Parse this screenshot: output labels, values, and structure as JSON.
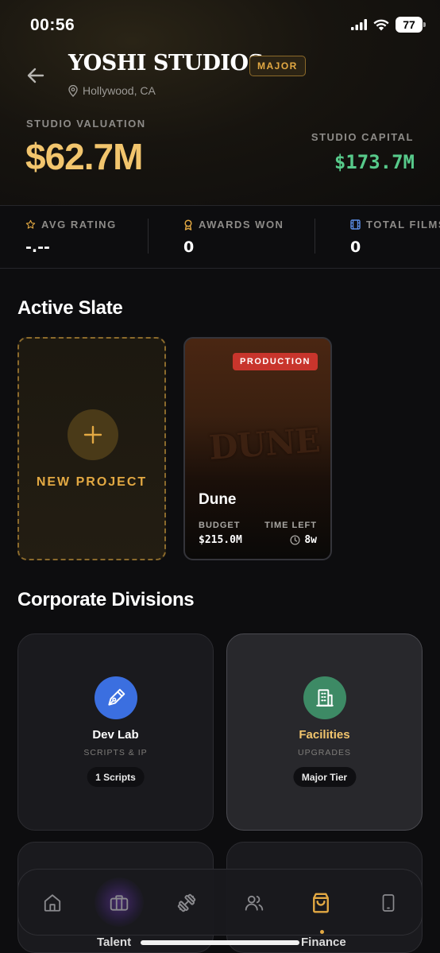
{
  "status_bar": {
    "time": "00:56",
    "battery": "77"
  },
  "header": {
    "studio_name": "YOSHI STUDIOS",
    "tier": "MAJOR",
    "location": "Hollywood, CA",
    "valuation_label": "STUDIO VALUATION",
    "valuation_value": "$62.7M",
    "capital_label": "STUDIO CAPITAL",
    "capital_value": "$173.7M"
  },
  "stats": [
    {
      "label": "AVG RATING",
      "value": "-.--",
      "icon": "star-icon"
    },
    {
      "label": "AWARDS WON",
      "value": "0",
      "icon": "award-icon"
    },
    {
      "label": "TOTAL FILMS",
      "value": "0",
      "icon": "film-icon"
    }
  ],
  "active_slate": {
    "title": "Active Slate",
    "new_project_label": "NEW PROJECT",
    "films": [
      {
        "status": "PRODUCTION",
        "art_text": "DUNE",
        "title": "Dune",
        "budget_label": "BUDGET",
        "budget": "$215.0M",
        "time_left_label": "TIME LEFT",
        "time_left": "8w"
      }
    ]
  },
  "divisions": {
    "title": "Corporate Divisions",
    "items": [
      {
        "title": "Dev Lab",
        "subtitle": "SCRIPTS & IP",
        "pill": "1 Scripts",
        "icon": "pen-nib-icon",
        "color": "#3b6fe0"
      },
      {
        "title": "Facilities",
        "subtitle": "UPGRADES",
        "pill": "Major Tier",
        "icon": "building-icon",
        "color": "#3d8a65"
      }
    ]
  },
  "bottom_nav": {
    "items": [
      "home-icon",
      "briefcase-icon",
      "dumbbell-icon",
      "users-icon",
      "shopping-bag-icon",
      "phone-icon"
    ],
    "active": "shopping-bag-icon",
    "peek_labels": [
      "Talent",
      "Finance"
    ]
  },
  "colors": {
    "gold": "#f2c56d",
    "accent": "#e3a943",
    "green": "#57c98a",
    "production_red": "#c8352c"
  }
}
